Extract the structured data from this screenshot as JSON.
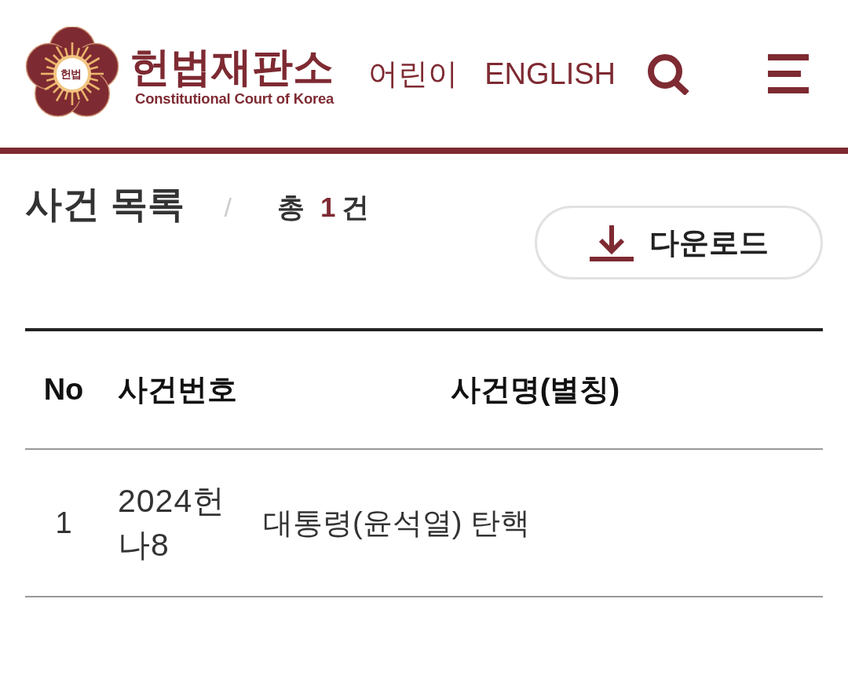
{
  "header": {
    "logo": {
      "emblem_text": "헌법",
      "title": "헌법재판소",
      "subtitle": "Constitutional Court of Korea"
    },
    "nav_links": [
      {
        "label": "어린이"
      },
      {
        "label": "ENGLISH"
      }
    ]
  },
  "list_header": {
    "title": "사건 목록",
    "separator": "/",
    "total": {
      "prefix": "총",
      "count": "1",
      "suffix": "건"
    },
    "download_button": "다운로드"
  },
  "table": {
    "columns": [
      "No",
      "사건번호",
      "사건명(별칭)"
    ],
    "rows": [
      [
        "1",
        "2024헌나8",
        "대통령(윤석열) 탄핵"
      ]
    ]
  }
}
